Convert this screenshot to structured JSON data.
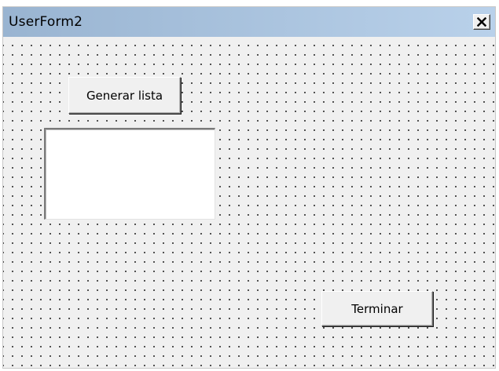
{
  "window": {
    "title": "UserForm2",
    "close_icon": "close-x-icon"
  },
  "form": {
    "generate_button_label": "Generar lista",
    "finish_button_label": "Terminar",
    "list_items": []
  },
  "colors": {
    "titlebar_start": "#99b4d1",
    "titlebar_end": "#b9d1ea",
    "form_background": "#f0f0f0",
    "grid_dot": "#2a2a2a",
    "listbox_background": "#ffffff"
  }
}
